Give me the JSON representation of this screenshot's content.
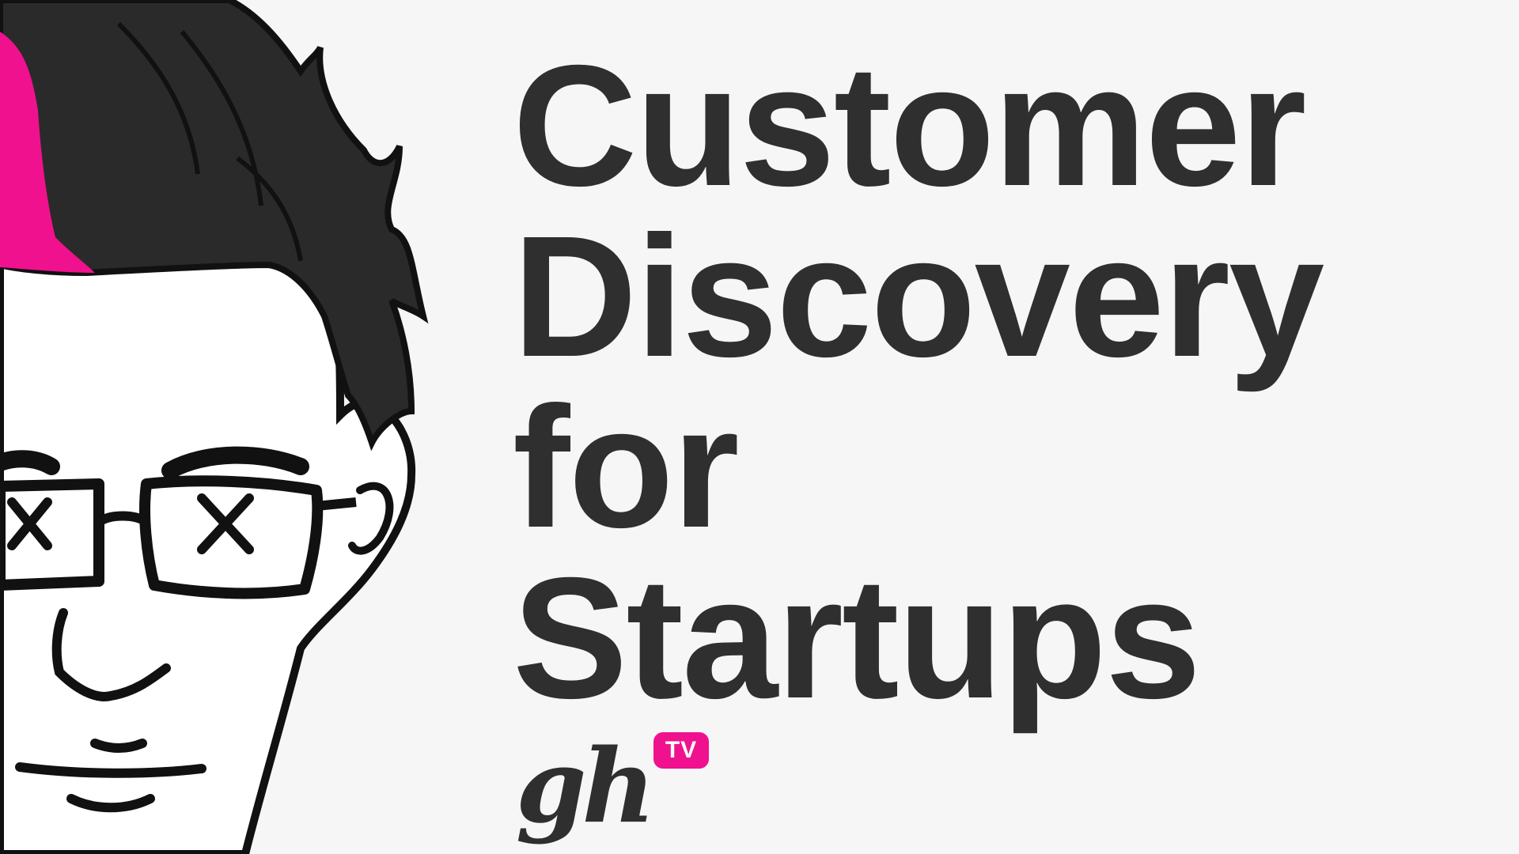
{
  "title": {
    "lines": [
      "Customer",
      "Discovery",
      "for",
      "Startups"
    ]
  },
  "logo": {
    "text": "gh",
    "badge": "TV"
  },
  "illustration": {
    "icon": "cartoon-face-icon"
  },
  "colors": {
    "background": "#f6f6f6",
    "text": "#2f2f2f",
    "accent": "#f0118f",
    "hair": "#2a2a2a"
  }
}
